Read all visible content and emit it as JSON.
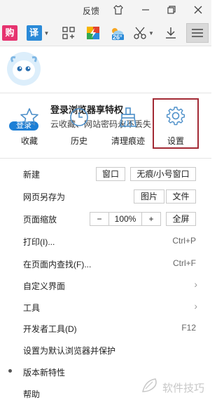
{
  "title_strip": {
    "feedback_label": "反馈"
  },
  "toolbar": {
    "shop_label": "购",
    "translate_label": "译",
    "weather_temp": "26°"
  },
  "account": {
    "title": "登录浏览器享特权",
    "subtitle": "云收藏、网站密码永不丢失",
    "login_label": "登录"
  },
  "quick_actions": [
    {
      "label": "收藏",
      "icon": "star-icon"
    },
    {
      "label": "历史",
      "icon": "clock-icon"
    },
    {
      "label": "清理痕迹",
      "icon": "broom-icon"
    },
    {
      "label": "设置",
      "icon": "gear-icon"
    }
  ],
  "menu": {
    "new": {
      "label": "新建",
      "window": "窗口",
      "incognito": "无痕/小号窗口"
    },
    "save_as": {
      "label": "网页另存为",
      "image": "图片",
      "file": "文件"
    },
    "zoom": {
      "label": "页面缩放",
      "minus": "−",
      "value": "100%",
      "plus": "+",
      "fullscreen": "全屏"
    },
    "print": {
      "label": "打印(I)...",
      "shortcut": "Ctrl+P"
    },
    "find": {
      "label": "在页面内查找(F)...",
      "shortcut": "Ctrl+F"
    },
    "customize": {
      "label": "自定义界面"
    },
    "tools": {
      "label": "工具"
    },
    "devtools": {
      "label": "开发者工具(D)",
      "shortcut": "F12"
    },
    "default_browser": {
      "label": "设置为默认浏览器并保护"
    },
    "new_features": {
      "label": "版本新特性"
    },
    "help": {
      "label": "帮助"
    }
  },
  "watermark": {
    "text": "软件技巧"
  },
  "colors": {
    "accent_blue": "#1c7fd6",
    "highlight_red": "#a32a35"
  }
}
